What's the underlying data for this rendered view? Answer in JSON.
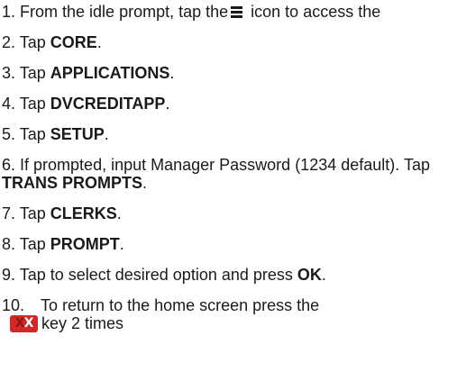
{
  "steps": [
    {
      "number": "1.",
      "before": "From the idle prompt, tap the",
      "icon": "menu-icon",
      "after": "icon to access the"
    },
    {
      "number": "2.",
      "text": "Tap",
      "bold": "CORE",
      "end": "."
    },
    {
      "number": "3.",
      "text": "Tap",
      "bold": "APPLICATIONS",
      "end": "."
    },
    {
      "number": "4.",
      "text": "Tap",
      "bold": "DVCREDITAPP",
      "end": "."
    },
    {
      "number": "5.",
      "text": "Tap",
      "bold": "SETUP",
      "end": "."
    },
    {
      "number": "6.",
      "text": "If prompted, input Manager Password (1234 default). Tap",
      "bold": "TRANS PROMPTS",
      "end": "."
    },
    {
      "number": "7.",
      "text": "Tap",
      "bold": "CLERKS",
      "end": "."
    },
    {
      "number": "8.",
      "text": "Tap",
      "bold": "PROMPT",
      "end": "."
    },
    {
      "number": "9.",
      "text": "Tap to select desired option and press",
      "bold": "OK",
      "end": "."
    },
    {
      "number": "10.",
      "text": "To return to the home screen press the",
      "key_icon": "cancel-key-icon",
      "key_label": "X",
      "after": "key 2 times"
    }
  ],
  "colors": {
    "text": "#1a1a1a",
    "cancel_key": "#d42727",
    "cancel_key_shadow": "#8f1414"
  }
}
